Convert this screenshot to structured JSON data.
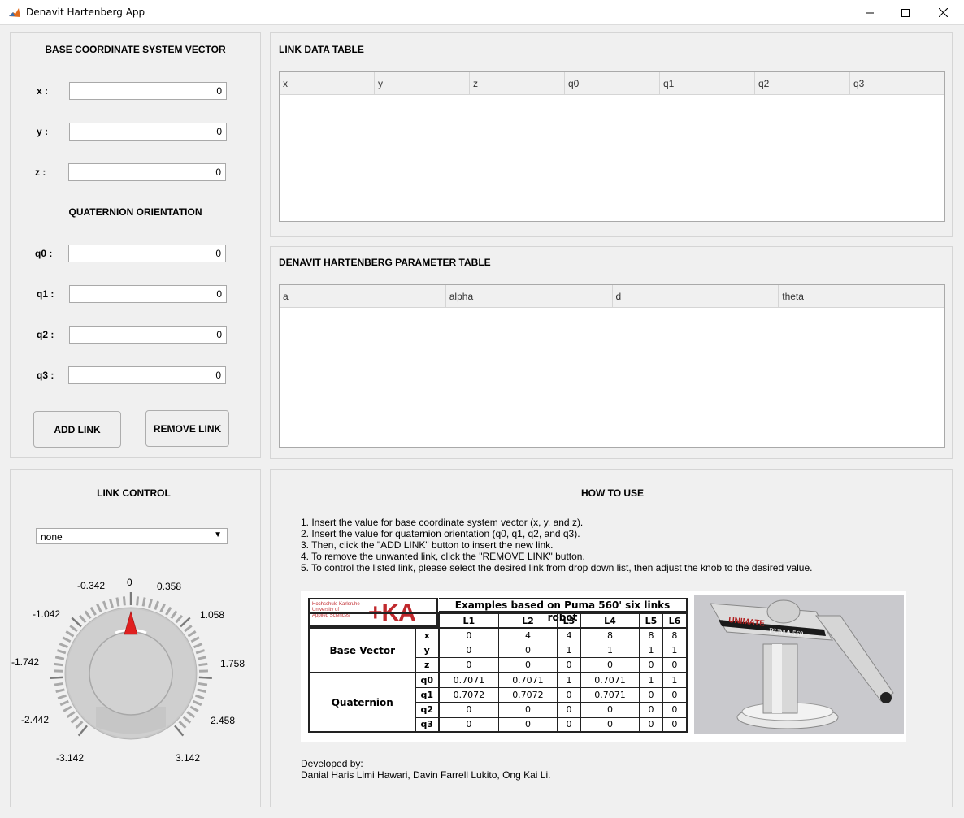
{
  "window": {
    "title": "Denavit Hartenberg App",
    "minimize": "—",
    "maximize": "☐",
    "close": "✕"
  },
  "base_panel": {
    "title": "BASE COORDINATE SYSTEM VECTOR",
    "x_label": "x :",
    "x_value": "0",
    "y_label": "y :",
    "y_value": "0",
    "z_label": "z :",
    "z_value": "0",
    "quat_title": "QUATERNION ORIENTATION",
    "q0_label": "q0 :",
    "q0_value": "0",
    "q1_label": "q1 :",
    "q1_value": "0",
    "q2_label": "q2 :",
    "q2_value": "0",
    "q3_label": "q3 :",
    "q3_value": "0",
    "add_link": "ADD LINK",
    "remove_link": "REMOVE LINK"
  },
  "link_table": {
    "title": "LINK DATA TABLE",
    "columns": [
      "x",
      "y",
      "z",
      "q0",
      "q1",
      "q2",
      "q3"
    ]
  },
  "dh_table": {
    "title": "DENAVIT HARTENBERG PARAMETER TABLE",
    "columns": [
      "a",
      "alpha",
      "d",
      "theta"
    ]
  },
  "link_control": {
    "title": "LINK CONTROL",
    "dropdown_value": "none",
    "knob_value": 0,
    "knob_labels": [
      "-0.342",
      "0",
      "0.358",
      "-1.042",
      "1.058",
      "-1.742",
      "1.758",
      "-2.442",
      "2.458",
      "-3.142",
      "3.142"
    ]
  },
  "how_to_use": {
    "title": "HOW TO USE",
    "steps": [
      "1. Insert the value for base coordinate system vector (x, y, and z).",
      "2. Insert the value for quaternion orientation (q0, q1, q2, and q3).",
      "3. Then, click the \"ADD LINK\" button to insert the new link.",
      "4. To remove the unwanted link, click the \"REMOVE LINK\" button.",
      "5. To control the listed link, please select the desired link from drop down list, then adjust the knob to the desired value."
    ],
    "developed_by_label": "Developed by:",
    "developers": "Danial Haris Limi Hawari, Davin Farrell Lukito, Ong Kai Li."
  },
  "figure": {
    "logo_small_line1": "Hochschule Karlsruhe",
    "logo_small_line2": "University of",
    "logo_small_line3": "Applied Sciences",
    "logo_big": "+KA",
    "title": "Examples based on Puma 560' six links robot",
    "links": [
      "L1",
      "L2",
      "L3",
      "L4",
      "L5",
      "L6"
    ],
    "group_base": "Base Vector",
    "group_quat": "Quaternion",
    "rows": [
      {
        "name": "x",
        "values": [
          "0",
          "4",
          "4",
          "8",
          "8",
          "8"
        ]
      },
      {
        "name": "y",
        "values": [
          "0",
          "0",
          "1",
          "1",
          "1",
          "1"
        ]
      },
      {
        "name": "z",
        "values": [
          "0",
          "0",
          "0",
          "0",
          "0",
          "0"
        ]
      },
      {
        "name": "q0",
        "values": [
          "0.7071",
          "0.7071",
          "1",
          "0.7071",
          "1",
          "1"
        ]
      },
      {
        "name": "q1",
        "values": [
          "0.7072",
          "0.7072",
          "0",
          "0.7071",
          "0",
          "0"
        ]
      },
      {
        "name": "q2",
        "values": [
          "0",
          "0",
          "0",
          "0",
          "0",
          "0"
        ]
      },
      {
        "name": "q3",
        "values": [
          "0",
          "0",
          "0",
          "0",
          "0",
          "0"
        ]
      }
    ],
    "robot_brand": "UNIMATE",
    "robot_model": "PUMA 560"
  }
}
